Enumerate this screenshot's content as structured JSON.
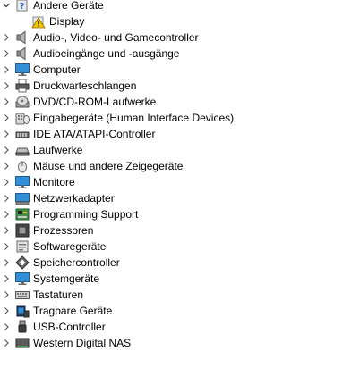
{
  "tree": {
    "root": {
      "label": "Andere Geräte",
      "expanded": true,
      "icon": "unknown-device-icon",
      "children": [
        {
          "label": "Display",
          "icon": "warning-device-icon"
        }
      ]
    },
    "categories": [
      {
        "label": "Audio-, Video- und Gamecontroller",
        "icon": "speaker-icon"
      },
      {
        "label": "Audioeingänge und -ausgänge",
        "icon": "speaker-icon"
      },
      {
        "label": "Computer",
        "icon": "monitor-icon"
      },
      {
        "label": "Druckwarteschlangen",
        "icon": "printer-icon"
      },
      {
        "label": "DVD/CD-ROM-Laufwerke",
        "icon": "disc-drive-icon"
      },
      {
        "label": "Eingabegeräte (Human Interface Devices)",
        "icon": "hid-icon"
      },
      {
        "label": "IDE ATA/ATAPI-Controller",
        "icon": "ide-controller-icon"
      },
      {
        "label": "Laufwerke",
        "icon": "hard-drive-icon"
      },
      {
        "label": "Mäuse und andere Zeigegeräte",
        "icon": "mouse-icon"
      },
      {
        "label": "Monitore",
        "icon": "monitor-icon"
      },
      {
        "label": "Netzwerkadapter",
        "icon": "network-adapter-icon"
      },
      {
        "label": "Programming Support",
        "icon": "chip-board-icon"
      },
      {
        "label": "Prozessoren",
        "icon": "processor-icon"
      },
      {
        "label": "Softwaregeräte",
        "icon": "software-device-icon"
      },
      {
        "label": "Speichercontroller",
        "icon": "storage-controller-icon"
      },
      {
        "label": "Systemgeräte",
        "icon": "system-device-icon"
      },
      {
        "label": "Tastaturen",
        "icon": "keyboard-icon"
      },
      {
        "label": "Tragbare Geräte",
        "icon": "portable-device-icon"
      },
      {
        "label": "USB-Controller",
        "icon": "usb-icon"
      },
      {
        "label": "Western Digital NAS",
        "icon": "nas-icon"
      }
    ]
  },
  "colors": {
    "monitor_blue": "#2f8fd8",
    "warning_yellow": "#f5c400",
    "text": "#000000"
  }
}
